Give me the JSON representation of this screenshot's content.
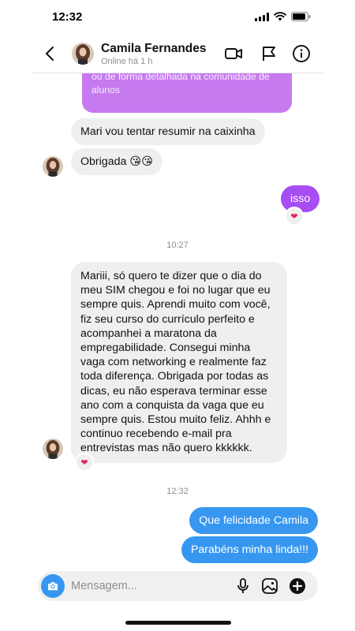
{
  "status_bar": {
    "time": "12:32"
  },
  "header": {
    "contact_name": "Camila Fernandes",
    "contact_status": "Online há 1 h"
  },
  "quoted_message": {
    "lines": [
      "ou de forma detalhada na comunidade de",
      "alunos"
    ]
  },
  "messages": {
    "m1": "Mari vou tentar resumir na caixinha",
    "m2": "Obrigada 😘😘",
    "m3": "isso",
    "time1": "10:27",
    "m4": "Mariii, só quero te dizer que o dia do meu SIM chegou e foi no lugar que eu sempre quis. Aprendi muito com você, fiz seu curso do currículo perfeito e acompanhei a maratona da empregabilidade. Consegui minha vaga com networking e realmente faz toda diferença. Obrigada por todas as dicas, eu não esperava terminar esse ano com a conquista da vaga que eu sempre quis. Estou muito feliz. Ahhh e continuo recebendo e-mail pra entrevistas mas não quero kkkkkk.",
    "time2": "12:32",
    "m5": "Que felicidade Camila",
    "m6": "Parabéns minha linda!!!"
  },
  "reactions": {
    "r1": "❤",
    "r2": "❤"
  },
  "composer": {
    "placeholder": "Mensagem..."
  },
  "colors": {
    "accent": "#3797f0",
    "purple": "#a64df4",
    "bubble_in": "#efefef"
  },
  "icons": [
    "back-icon",
    "video-call-icon",
    "flag-icon",
    "info-icon",
    "camera-icon",
    "microphone-icon",
    "gallery-icon",
    "add-icon"
  ]
}
